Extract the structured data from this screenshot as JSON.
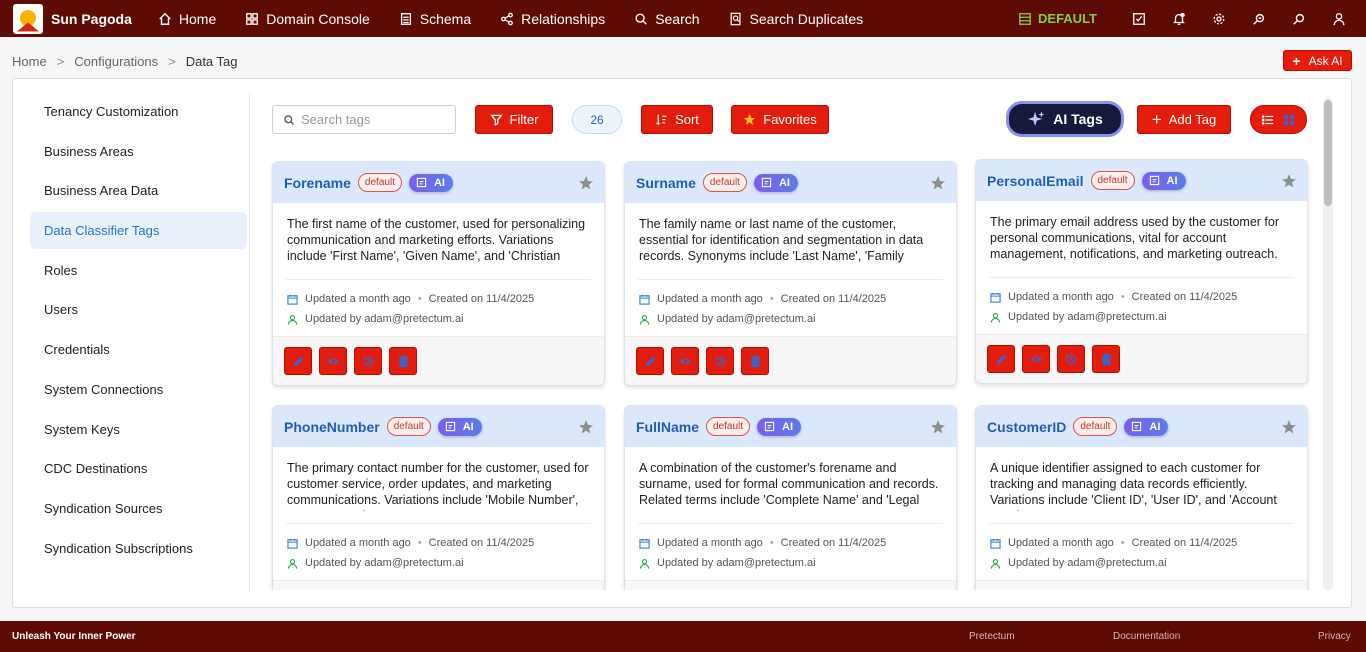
{
  "app": {
    "brand": "Sun Pagoda",
    "nav": [
      {
        "label": "Home",
        "icon": "home-icon"
      },
      {
        "label": "Domain Console",
        "icon": "grid-icon"
      },
      {
        "label": "Schema",
        "icon": "schema-icon"
      },
      {
        "label": "Relationships",
        "icon": "share-icon"
      },
      {
        "label": "Search",
        "icon": "search-icon"
      },
      {
        "label": "Search Duplicates",
        "icon": "search-duplicates-icon"
      }
    ],
    "environment": "DEFAULT",
    "colors": {
      "topbar": "#5e0a05",
      "accent": "#e31c0c",
      "env": "#7fd14a",
      "link": "#1f5fb3"
    }
  },
  "breadcrumb": [
    "Home",
    "Configurations",
    "Data Tag"
  ],
  "ask_ai_label": "Ask AI",
  "sidebar": {
    "items": [
      {
        "label": "Tenancy Customization"
      },
      {
        "label": "Business Areas"
      },
      {
        "label": "Business Area Data"
      },
      {
        "label": "Data Classifier Tags"
      },
      {
        "label": "Roles"
      },
      {
        "label": "Users"
      },
      {
        "label": "Credentials"
      },
      {
        "label": "System Connections"
      },
      {
        "label": "System Keys"
      },
      {
        "label": "CDC Destinations"
      },
      {
        "label": "Syndication Sources"
      },
      {
        "label": "Syndication Subscriptions"
      }
    ],
    "active": "Data Classifier Tags"
  },
  "toolbar": {
    "search_placeholder": "Search tags",
    "filter_label": "Filter",
    "count": "26",
    "sort_label": "Sort",
    "favorites_label": "Favorites",
    "ai_tags_label": "AI Tags",
    "add_tag_label": "Add Tag"
  },
  "cards": [
    {
      "title": "Forename",
      "badge": "default",
      "ai": "AI",
      "description": "The first name of the customer, used for personalizing communication and marketing efforts. Variations include 'First Name', 'Given Name', and 'Christian Name'.",
      "updated": "Updated a month ago",
      "created": "Created on 11/4/2025",
      "updated_by": "Updated by adam@pretectum.ai"
    },
    {
      "title": "Surname",
      "badge": "default",
      "ai": "AI",
      "description": "The family name or last name of the customer, essential for identification and segmentation in data records. Synonyms include 'Last Name', 'Family Name'.",
      "updated": "Updated a month ago",
      "created": "Created on 11/4/2025",
      "updated_by": "Updated by adam@pretectum.ai"
    },
    {
      "title": "PersonalEmail",
      "badge": "default",
      "ai": "AI",
      "description": "The primary email address used by the customer for personal communications, vital for account management, notifications, and marketing outreach.",
      "updated": "Updated a month ago",
      "created": "Created on 11/4/2025",
      "updated_by": "Updated by adam@pretectum.ai"
    },
    {
      "title": "PhoneNumber",
      "badge": "default",
      "ai": "AI",
      "description": "The primary contact number for the customer, used for customer service, order updates, and marketing communications. Variations include 'Mobile Number', 'Contact Number'.",
      "updated": "Updated a month ago",
      "created": "Created on 11/4/2025",
      "updated_by": "Updated by adam@pretectum.ai"
    },
    {
      "title": "FullName",
      "badge": "default",
      "ai": "AI",
      "description": "A combination of the customer's forename and surname, used for formal communication and records. Related terms include 'Complete Name' and 'Legal Name'.",
      "updated": "Updated a month ago",
      "created": "Created on 11/4/2025",
      "updated_by": "Updated by adam@pretectum.ai"
    },
    {
      "title": "CustomerID",
      "badge": "default",
      "ai": "AI",
      "description": "A unique identifier assigned to each customer for tracking and managing data records efficiently. Variations include 'Client ID', 'User ID', and 'Account Number'.",
      "updated": "Updated a month ago",
      "created": "Created on 11/4/2025",
      "updated_by": "Updated by adam@pretectum.ai"
    }
  ],
  "footer": {
    "tagline": "Unleash Your Inner Power",
    "links": [
      "Pretectum",
      "Documentation",
      "Privacy"
    ]
  }
}
